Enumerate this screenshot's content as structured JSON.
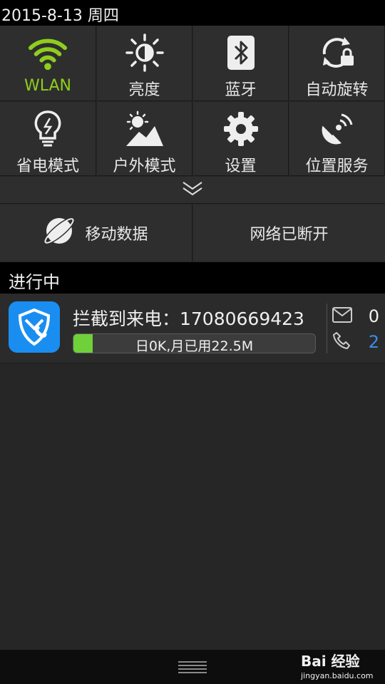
{
  "status_bar": {
    "date": "2015-8-13 周四"
  },
  "quick_settings": {
    "tiles": [
      {
        "label": "WLAN",
        "icon": "wifi-icon",
        "active": true
      },
      {
        "label": "亮度",
        "icon": "brightness-icon",
        "active": false
      },
      {
        "label": "蓝牙",
        "icon": "bluetooth-icon",
        "active": false
      },
      {
        "label": "自动旋转",
        "icon": "rotate-lock-icon",
        "active": false
      },
      {
        "label": "省电模式",
        "icon": "power-saving-icon",
        "active": false
      },
      {
        "label": "户外模式",
        "icon": "outdoor-sun-icon",
        "active": false
      },
      {
        "label": "设置",
        "icon": "gear-icon",
        "active": false
      },
      {
        "label": "位置服务",
        "icon": "location-service-icon",
        "active": false
      }
    ],
    "expand_icon": "double-chevron-down-icon",
    "mobile_data": {
      "label": "移动数据",
      "icon": "planet-icon"
    },
    "network_status": {
      "label": "网络已断开"
    }
  },
  "ongoing": {
    "section_title": "进行中",
    "notification": {
      "app_icon": "shield-phone-icon",
      "title": "拦截到来电：17080669423",
      "usage_text": "日0K,月已用22.5M",
      "usage_fraction": 0.08,
      "sms_blocked": "0",
      "calls_blocked": "2"
    }
  },
  "watermark": {
    "brand": "Bai 经验",
    "url": "jingyan.baidu.com"
  },
  "colors": {
    "accent_green": "#8fce1e",
    "progress_green": "#6fd03a",
    "app_blue": "#1a8ef0",
    "count_blue": "#3a8ee8"
  }
}
